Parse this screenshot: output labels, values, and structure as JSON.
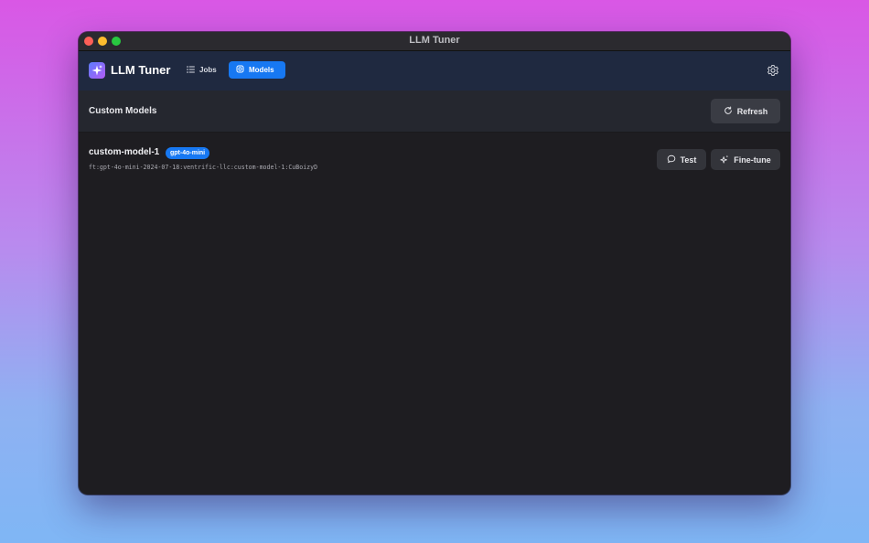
{
  "window": {
    "title": "LLM Tuner"
  },
  "app": {
    "name": "LLM Tuner",
    "accent_color": "#1778f2",
    "logo_icon": "sparkles-icon"
  },
  "nav": {
    "tabs": [
      {
        "label": "Jobs",
        "icon": "list-icon",
        "active": false
      },
      {
        "label": "Models",
        "icon": "cube-icon",
        "active": true
      }
    ],
    "settings_icon": "gear-icon"
  },
  "section": {
    "title": "Custom Models",
    "refresh_label": "Refresh",
    "refresh_icon": "refresh-icon"
  },
  "models": [
    {
      "name": "custom-model-1",
      "base_model": "gpt-4o-mini",
      "id": "ft:gpt-4o-mini-2024-07-18:ventrific-llc:custom-model-1:CuBoizyD",
      "test_label": "Test",
      "test_icon": "chat-bubble-icon",
      "finetune_label": "Fine-tune",
      "finetune_icon": "sparkle-icon"
    }
  ]
}
